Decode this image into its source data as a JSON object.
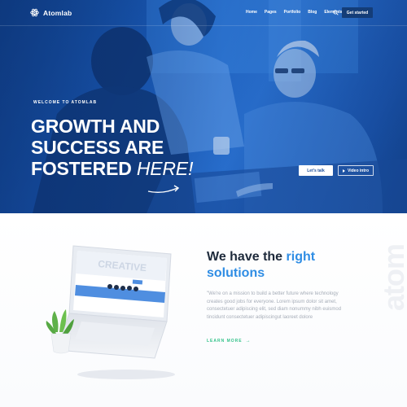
{
  "brand": {
    "name": "Atomlab"
  },
  "nav": {
    "items": [
      "Home",
      "Pages",
      "Portfolio",
      "Blog",
      "Elements"
    ],
    "cta_label": "Get started"
  },
  "hero": {
    "kicker": "WELCOME TO ATOMLAB",
    "headline_lines": [
      "GROWTH AND",
      "SUCCESS ARE",
      "FOSTERED"
    ],
    "headline_emphasis": "HERE!",
    "primary_button": "Let's talk",
    "secondary_button": "Video intro"
  },
  "solutions": {
    "title_start": "We have the",
    "title_accent": "right",
    "title_end": "solutions",
    "body": "\"We're on a mission to build a better future where technology creates good jobs for everyone. Lorem ipsum dolor sit amet, consectetuer adipiscing elit, sed diam nonummy nibh euismod tincidunt consectetuer adipiscingut laoreet dolore",
    "link_label": "LEARN MORE",
    "watermark": "atom"
  },
  "mockup": {
    "screen_word": "CREATIVE"
  },
  "colors": {
    "hero_blue": "#1a5bb8",
    "accent_blue": "#2f8de4",
    "link_green": "#33c28a",
    "nav_button": "#143d78"
  }
}
